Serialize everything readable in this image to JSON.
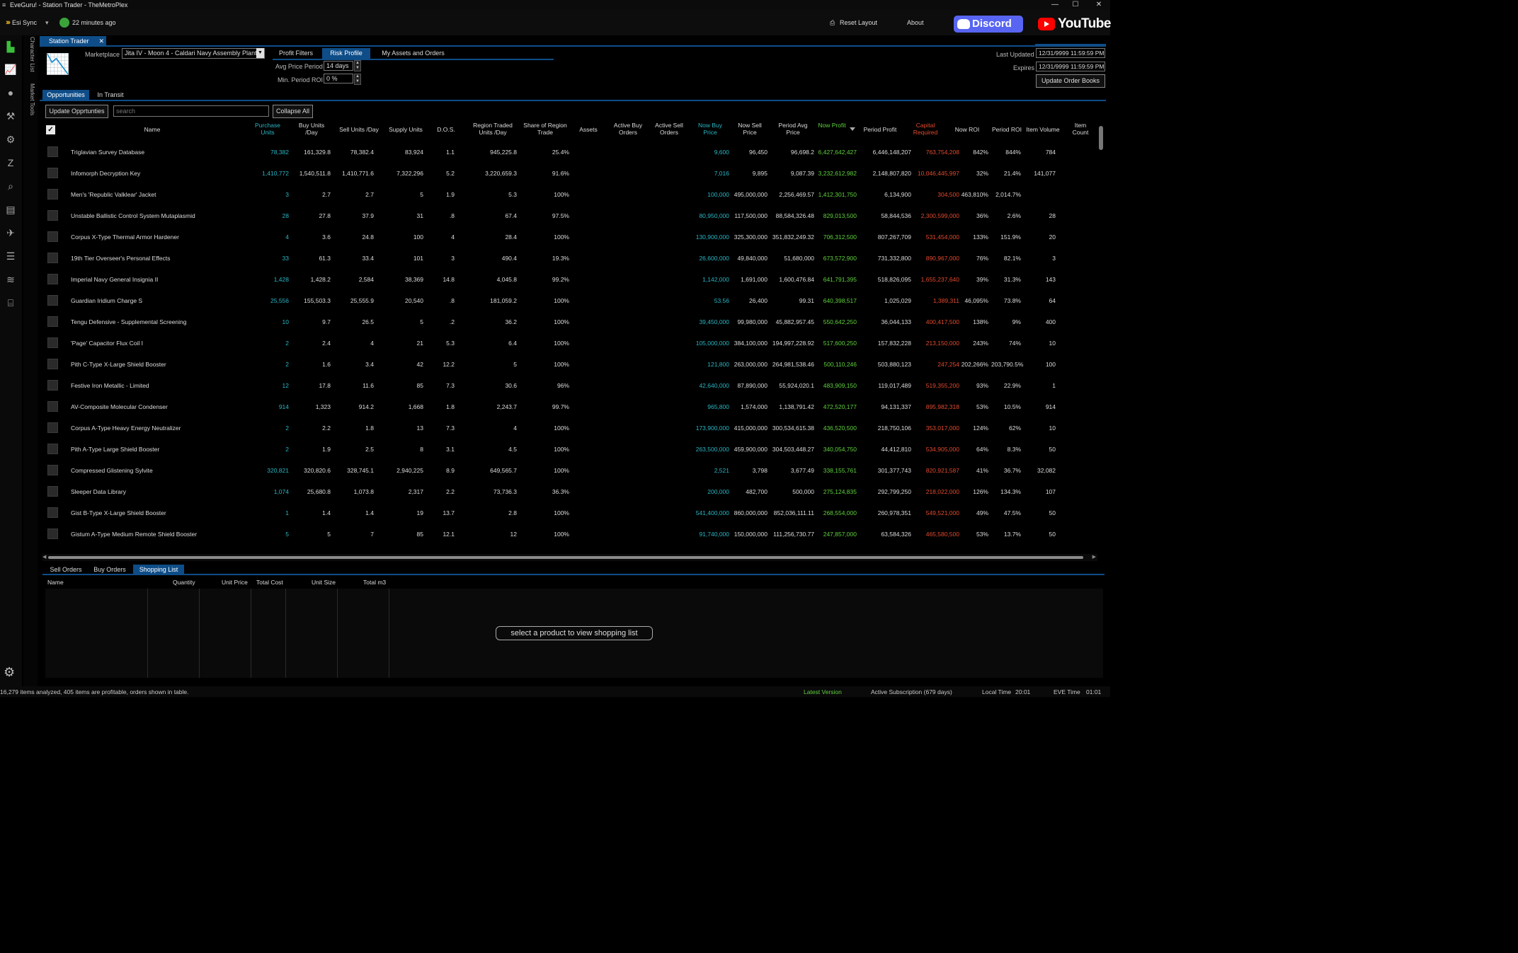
{
  "window": {
    "title": "EveGuru! - Station Trader - TheMetroPlex",
    "menu_icon": "≡",
    "minimize": "—",
    "maximize": "☐",
    "close": "✕"
  },
  "topbar": {
    "esi_label": "Esi Sync",
    "esi_caret": "▾",
    "sync_time": "22 minutes ago",
    "reset_layout": "Reset Layout",
    "about": "About",
    "discord": "Discord",
    "youtube": "YouTube"
  },
  "side_tabs": {
    "character_list": "Character List",
    "market_tools": "Market Tools"
  },
  "doc_tab": {
    "label": "Station Trader",
    "close": "✕"
  },
  "controls": {
    "marketplace_label": "Marketplace",
    "marketplace_value": "Jita IV - Moon 4 - Caldari Navy Assembly Plant",
    "avg_price_period_label": "Avg Price Period",
    "avg_price_period_value": "14 days",
    "min_period_roi_label": "Min. Period ROI",
    "min_period_roi_value": "0 %",
    "last_updated_label": "Last Updated",
    "last_updated_value": "12/31/9999 11:59:59 PM",
    "expires_label": "Expires",
    "expires_value": "12/31/9999 11:59:59 PM",
    "update_order_books": "Update Order Books"
  },
  "profile_tabs": [
    "Profit Filters",
    "Risk Profile",
    "My Assets and Orders"
  ],
  "view_tabs": [
    "Opportunities",
    "In Transit"
  ],
  "toolbar": {
    "update_button": "Update Opprtunties",
    "search_placeholder": "search",
    "collapse_all": "Collapse All"
  },
  "columns": [
    "Name",
    "Purchase Units",
    "Buy Units /Day",
    "Sell Units /Day",
    "Supply Units",
    "D.O.S.",
    "Region Traded Units /Day",
    "Share of Region Trade",
    "Assets",
    "Active Buy Orders",
    "Active Sell Orders",
    "Now Buy Price",
    "Now Sell Price",
    "Period Avg Price",
    "Now Profit",
    "Period Profit",
    "Capital Required",
    "Now ROI",
    "Period ROI",
    "Item Volume",
    "Item Count"
  ],
  "check_mark": "✓",
  "rows": [
    [
      "Triglavian Survey Database",
      "78,382",
      "161,329.8",
      "78,382.4",
      "83,924",
      "1.1",
      "945,225.8",
      "25.4%",
      "",
      "",
      "",
      "9,600",
      "96,450",
      "96,698.2",
      "6,427,642,427",
      "6,446,148,207",
      "763,754,208",
      "842%",
      "844%",
      "784",
      ""
    ],
    [
      "Infomorph Decryption Key",
      "1,410,772",
      "1,540,511.8",
      "1,410,771.6",
      "7,322,296",
      "5.2",
      "3,220,659.3",
      "91.6%",
      "",
      "",
      "",
      "7,016",
      "9,895",
      "9,087.39",
      "3,232,612,982",
      "2,148,807,820",
      "10,046,445,997",
      "32%",
      "21.4%",
      "141,077",
      ""
    ],
    [
      "Men's 'Republic Valklear' Jacket",
      "3",
      "2.7",
      "2.7",
      "5",
      "1.9",
      "5.3",
      "100%",
      "",
      "",
      "",
      "100,000",
      "495,000,000",
      "2,256,469.57",
      "1,412,301,750",
      "6,134,900",
      "304,500",
      "463,810%",
      "2,014.7%",
      "",
      ""
    ],
    [
      "Unstable Ballistic Control System Mutaplasmid",
      "28",
      "27.8",
      "37.9",
      "31",
      ".8",
      "67.4",
      "97.5%",
      "",
      "",
      "",
      "80,950,000",
      "117,500,000",
      "88,584,326.48",
      "829,013,500",
      "58,844,536",
      "2,300,599,000",
      "36%",
      "2.6%",
      "28",
      ""
    ],
    [
      "Corpus X-Type Thermal Armor Hardener",
      "4",
      "3.6",
      "24.8",
      "100",
      "4",
      "28.4",
      "100%",
      "",
      "",
      "",
      "130,900,000",
      "325,300,000",
      "351,832,249.32",
      "706,312,500",
      "807,267,709",
      "531,454,000",
      "133%",
      "151.9%",
      "20",
      ""
    ],
    [
      "19th Tier Overseer's Personal Effects",
      "33",
      "61.3",
      "33.4",
      "101",
      "3",
      "490.4",
      "19.3%",
      "",
      "",
      "",
      "26,600,000",
      "49,840,000",
      "51,680,000",
      "673,572,900",
      "731,332,800",
      "890,967,000",
      "76%",
      "82.1%",
      "3",
      ""
    ],
    [
      "Imperial Navy General Insignia II",
      "1,428",
      "1,428.2",
      "2,584",
      "38,369",
      "14.8",
      "4,045.8",
      "99.2%",
      "",
      "",
      "",
      "1,142,000",
      "1,691,000",
      "1,600,476.84",
      "641,791,395",
      "518,826,095",
      "1,655,237,640",
      "39%",
      "31.3%",
      "143",
      ""
    ],
    [
      "Guardian Iridium Charge S",
      "25,556",
      "155,503.3",
      "25,555.9",
      "20,540",
      ".8",
      "181,059.2",
      "100%",
      "",
      "",
      "",
      "53.56",
      "26,400",
      "99.31",
      "640,398,517",
      "1,025,029",
      "1,389,311",
      "46,095%",
      "73.8%",
      "64",
      ""
    ],
    [
      "Tengu Defensive - Supplemental Screening",
      "10",
      "9.7",
      "26.5",
      "5",
      ".2",
      "36.2",
      "100%",
      "",
      "",
      "",
      "39,450,000",
      "99,980,000",
      "45,882,957.45",
      "550,642,250",
      "36,044,133",
      "400,417,500",
      "138%",
      "9%",
      "400",
      ""
    ],
    [
      "'Page' Capacitor Flux Coil I",
      "2",
      "2.4",
      "4",
      "21",
      "5.3",
      "6.4",
      "100%",
      "",
      "",
      "",
      "105,000,000",
      "384,100,000",
      "194,997,228.92",
      "517,600,250",
      "157,832,228",
      "213,150,000",
      "243%",
      "74%",
      "10",
      ""
    ],
    [
      "Pith C-Type X-Large Shield Booster",
      "2",
      "1.6",
      "3.4",
      "42",
      "12.2",
      "5",
      "100%",
      "",
      "",
      "",
      "121,800",
      "263,000,000",
      "264,981,538.46",
      "500,110,246",
      "503,880,123",
      "247,254",
      "202,266%",
      "203,790.5%",
      "100",
      ""
    ],
    [
      "Festive Iron Metallic - Limited",
      "12",
      "17.8",
      "11.6",
      "85",
      "7.3",
      "30.6",
      "96%",
      "",
      "",
      "",
      "42,640,000",
      "87,890,000",
      "55,924,020.1",
      "483,909,150",
      "119,017,489",
      "519,355,200",
      "93%",
      "22.9%",
      "1",
      ""
    ],
    [
      "AV-Composite Molecular Condenser",
      "914",
      "1,323",
      "914.2",
      "1,668",
      "1.8",
      "2,243.7",
      "99.7%",
      "",
      "",
      "",
      "965,800",
      "1,574,000",
      "1,138,791.42",
      "472,520,177",
      "94,131,337",
      "895,982,318",
      "53%",
      "10.5%",
      "914",
      ""
    ],
    [
      "Corpus A-Type Heavy Energy Neutralizer",
      "2",
      "2.2",
      "1.8",
      "13",
      "7.3",
      "4",
      "100%",
      "",
      "",
      "",
      "173,900,000",
      "415,000,000",
      "300,534,615.38",
      "436,520,500",
      "218,750,106",
      "353,017,000",
      "124%",
      "62%",
      "10",
      ""
    ],
    [
      "Pith A-Type Large Shield Booster",
      "2",
      "1.9",
      "2.5",
      "8",
      "3.1",
      "4.5",
      "100%",
      "",
      "",
      "",
      "263,500,000",
      "459,900,000",
      "304,503,448.27",
      "340,054,750",
      "44,412,810",
      "534,905,000",
      "64%",
      "8.3%",
      "50",
      ""
    ],
    [
      "Compressed Glistening Sylvite",
      "320,821",
      "320,820.6",
      "328,745.1",
      "2,940,225",
      "8.9",
      "649,565.7",
      "100%",
      "",
      "",
      "",
      "2,521",
      "3,798",
      "3,677.49",
      "338,155,761",
      "301,377,743",
      "820,921,587",
      "41%",
      "36.7%",
      "32,082",
      ""
    ],
    [
      "Sleeper Data Library",
      "1,074",
      "25,680.8",
      "1,073.8",
      "2,317",
      "2.2",
      "73,736.3",
      "36.3%",
      "",
      "",
      "",
      "200,000",
      "482,700",
      "500,000",
      "275,124,835",
      "292,799,250",
      "218,022,000",
      "126%",
      "134.3%",
      "107",
      ""
    ],
    [
      "Gist B-Type X-Large Shield Booster",
      "1",
      "1.4",
      "1.4",
      "19",
      "13.7",
      "2.8",
      "100%",
      "",
      "",
      "",
      "541,400,000",
      "860,000,000",
      "852,036,111.11",
      "268,554,000",
      "260,978,351",
      "549,521,000",
      "49%",
      "47.5%",
      "50",
      ""
    ],
    [
      "Gistum A-Type Medium Remote Shield Booster",
      "5",
      "5",
      "7",
      "85",
      "12.1",
      "12",
      "100%",
      "",
      "",
      "",
      "91,740,000",
      "150,000,000",
      "111,256,730.77",
      "247,857,000",
      "63,584,326",
      "465,580,500",
      "53%",
      "13.7%",
      "50",
      ""
    ]
  ],
  "bottom_tabs": [
    "Sell Orders",
    "Buy Orders",
    "Shopping List"
  ],
  "shopping_list": {
    "columns": [
      "Name",
      "Quantity",
      "Unit Price",
      "Total Cost",
      "Unit Size",
      "Total m3"
    ],
    "empty_message": "select a product to view shopping list"
  },
  "status": {
    "summary": "16,279 items analyzed, 405 items are profitable,  orders shown in table.",
    "latest_version": "Latest Version",
    "subscription": "Active Subscription (679 days)",
    "local_time_label": "Local Time",
    "local_time": "20:01",
    "eve_time_label": "EVE Time",
    "eve_time": "01:01"
  },
  "colors": {
    "accent": "#0e4d88",
    "cyan": "#2bb5c4",
    "green": "#5fd13c",
    "red": "#e24a2e"
  }
}
